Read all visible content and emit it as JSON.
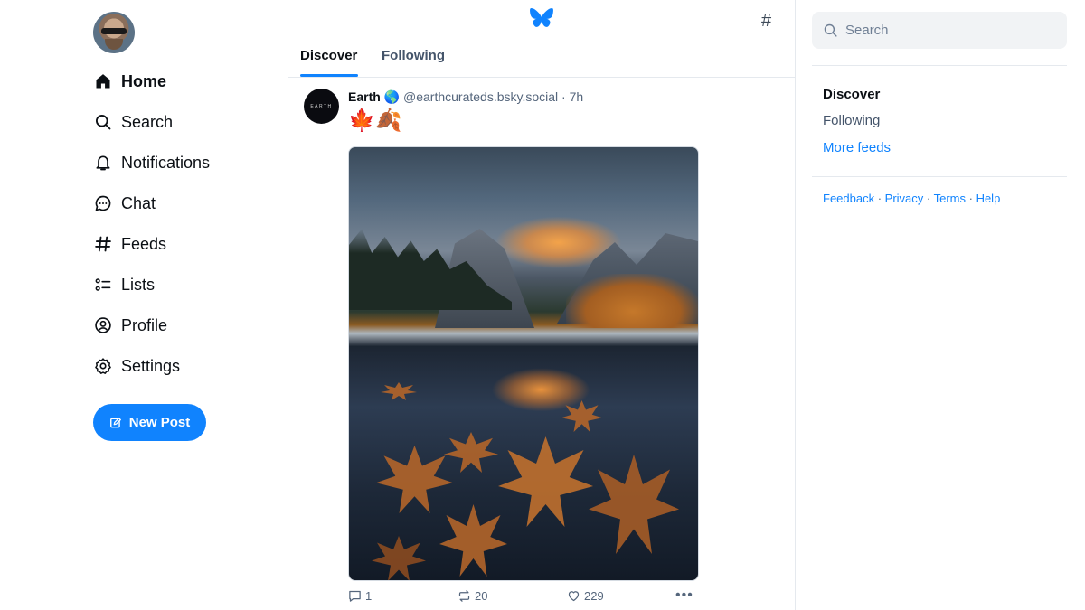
{
  "nav": {
    "items": [
      {
        "label": "Home",
        "icon": "home-icon",
        "active": true
      },
      {
        "label": "Search",
        "icon": "search-icon"
      },
      {
        "label": "Notifications",
        "icon": "bell-icon"
      },
      {
        "label": "Chat",
        "icon": "chat-bubble-icon"
      },
      {
        "label": "Feeds",
        "icon": "hash-icon"
      },
      {
        "label": "Lists",
        "icon": "list-icon"
      },
      {
        "label": "Profile",
        "icon": "user-circle-icon"
      },
      {
        "label": "Settings",
        "icon": "gear-icon"
      }
    ],
    "new_post_label": "New Post"
  },
  "header": {
    "logo": "butterfly-logo",
    "feeds_icon": "#",
    "tabs": [
      {
        "label": "Discover",
        "active": true
      },
      {
        "label": "Following"
      }
    ]
  },
  "post": {
    "author_name": "Earth",
    "author_emoji": "🌎",
    "handle": "@earthcurateds.bsky.social",
    "separator": "·",
    "time": "7h",
    "avatar_text": "EARTH",
    "text": "🍁🍂",
    "image_alt": "Autumn valley lake with floating maple leaves",
    "replies": "1",
    "reposts": "20",
    "likes": "229"
  },
  "right": {
    "search_placeholder": "Search",
    "feeds": [
      {
        "label": "Discover",
        "active": true
      },
      {
        "label": "Following"
      },
      {
        "label": "More feeds",
        "link": true
      }
    ],
    "footer": [
      "Feedback",
      "Privacy",
      "Terms",
      "Help"
    ],
    "footer_sep": " · "
  },
  "colors": {
    "accent": "#1083fe",
    "text": "#0b0f14",
    "muted": "#55667c",
    "border": "#e5e9ee"
  }
}
